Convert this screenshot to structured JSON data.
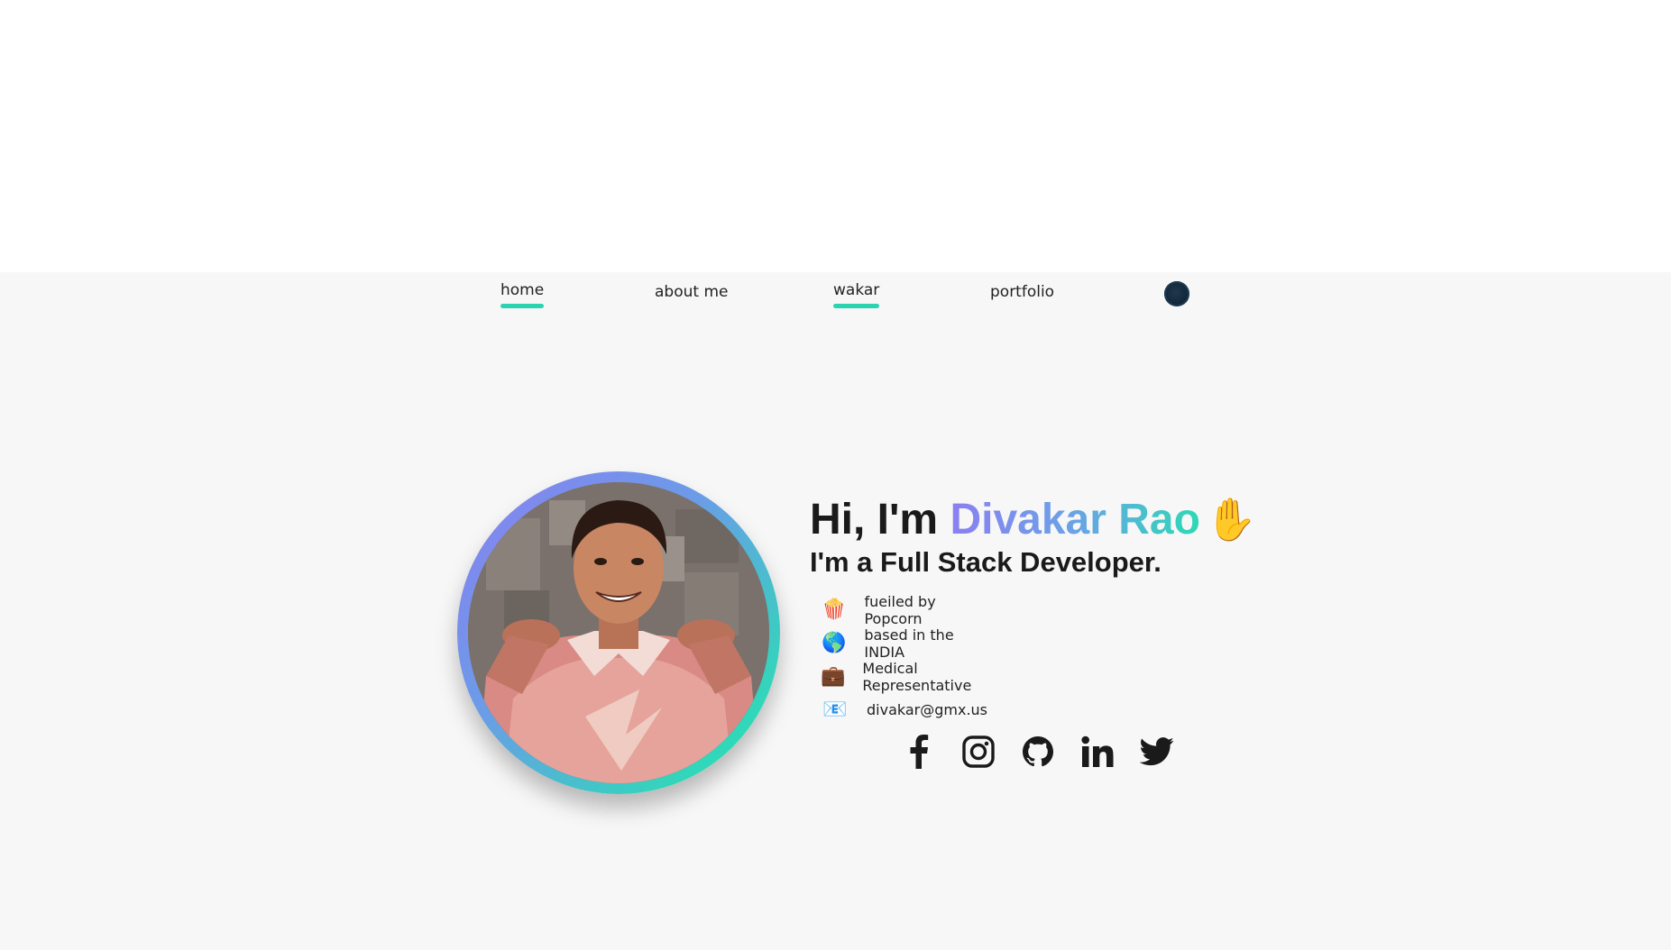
{
  "nav": {
    "items": [
      {
        "label": "home",
        "active": true
      },
      {
        "label": "about me",
        "active": false
      },
      {
        "label": "wakar",
        "active": true
      },
      {
        "label": "portfolio",
        "active": false
      }
    ],
    "theme_toggle_icon": "dark-mode-toggle-icon",
    "accent": "#2ad4b0"
  },
  "hero": {
    "greeting_prefix": "Hi, I'm ",
    "name": "Divakar Rao",
    "wave_emoji": "✋",
    "role": "I'm a Full Stack Developer.",
    "facts": [
      {
        "icon": "🍿",
        "icon_name": "popcorn-icon",
        "text": "fueiled by Popcorn"
      },
      {
        "icon": "🌎",
        "icon_name": "globe-icon",
        "text": "based in the INDIA"
      },
      {
        "icon": "💼",
        "icon_name": "briefcase-icon",
        "text": "Medical Representative"
      },
      {
        "icon": "📧",
        "icon_name": "email-icon",
        "text": "divakar@gmx.us"
      }
    ],
    "socials": [
      "facebook-icon",
      "instagram-icon",
      "github-icon",
      "linkedin-icon",
      "twitter-icon"
    ],
    "gradient_colors": [
      "#8b7ff2",
      "#6aa3e6",
      "#2fd8b5"
    ]
  }
}
